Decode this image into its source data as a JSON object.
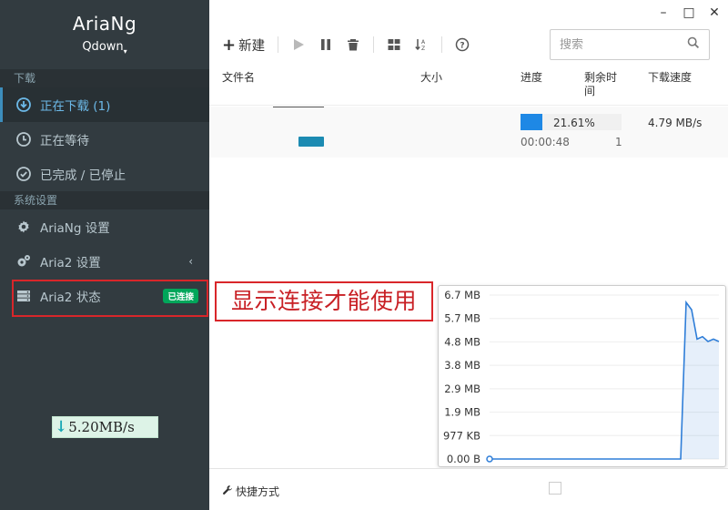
{
  "brand": {
    "title": "AriaNg",
    "subtitle": "Qdown"
  },
  "sidebar": {
    "download_header": "下载",
    "items": [
      {
        "label": "正在下载 (1)",
        "icon": "download-circle-icon"
      },
      {
        "label": "正在等待",
        "icon": "clock-icon"
      },
      {
        "label": "已完成 / 已停止",
        "icon": "check-circle-icon"
      }
    ],
    "settings_header": "系统设置",
    "settings_items": [
      {
        "label": "AriaNg 设置",
        "icon": "gear-icon"
      },
      {
        "label": "Aria2 设置",
        "icon": "gears-icon"
      },
      {
        "label": "Aria2 状态",
        "icon": "server-icon",
        "badge": "已连接"
      }
    ]
  },
  "speed_widget": {
    "arrow": "↓",
    "value": "5.20MB/s"
  },
  "toolbar": {
    "new_label": "新建",
    "search_placeholder": "搜索"
  },
  "table": {
    "headers": {
      "name": "文件名",
      "size": "大小",
      "progress": "进度",
      "remaining": "剩余时间",
      "speed": "下载速度"
    },
    "rows": [
      {
        "progress": "21.61%",
        "progress_fraction": 0.2161,
        "time": "00:00:48",
        "connections": "1",
        "speed": "4.79 MB/s"
      }
    ]
  },
  "annotation": "显示连接才能使用",
  "chart_data": {
    "type": "line",
    "title": "",
    "xlabel": "",
    "ylabel": "",
    "y_tick_labels": [
      "6.7 MB",
      "5.7 MB",
      "4.8 MB",
      "3.8 MB",
      "2.9 MB",
      "1.9 MB",
      "977 KB",
      "0.00 B"
    ],
    "ylim": [
      0,
      6.7
    ],
    "y_unit": "MB",
    "series": [
      {
        "color": "#2f7ed8",
        "values": [
          0,
          0,
          0,
          0,
          0,
          0,
          0,
          0,
          0,
          0,
          0,
          0,
          0,
          0,
          0,
          0,
          0,
          0,
          0,
          0,
          0,
          0,
          0,
          0,
          0,
          0,
          0,
          0,
          0,
          0,
          0,
          0,
          0,
          0,
          0,
          0,
          6.4,
          6.1,
          4.9,
          5.0,
          4.8,
          4.9,
          4.8
        ]
      }
    ],
    "grid": true,
    "legend": "none"
  },
  "footer": {
    "shortcut_label": "快捷方式"
  },
  "colors": {
    "sidebar_bg": "#323b40",
    "accent": "#3c8dbc",
    "badge": "#00a65a",
    "annotation_red": "#d9262a",
    "progress": "#1e88e5"
  }
}
